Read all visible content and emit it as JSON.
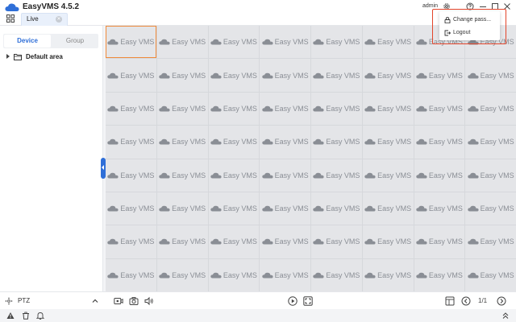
{
  "app": {
    "title": "EasyVMS 4.5.2"
  },
  "tabs": [
    {
      "label": "Live"
    }
  ],
  "header": {
    "user": "admin"
  },
  "sidebar": {
    "tabs": [
      {
        "label": "Device"
      },
      {
        "label": "Group"
      }
    ],
    "tree": [
      {
        "label": "Default area"
      }
    ]
  },
  "grid": {
    "rows": 8,
    "cols": 8,
    "cell_label": "Easy VMS",
    "selected_cell": 1
  },
  "toolbar": {
    "ptz_label": "PTZ",
    "page_indicator": "1/1"
  },
  "user_menu": {
    "items": [
      {
        "label": "Change pass...",
        "icon": "lock-icon"
      },
      {
        "label": "Logout",
        "icon": "logout-icon"
      }
    ]
  },
  "colors": {
    "accent": "#2f6fd8",
    "selected_cell_border": "#f08a3a",
    "annotation_box": "#e3452b"
  }
}
